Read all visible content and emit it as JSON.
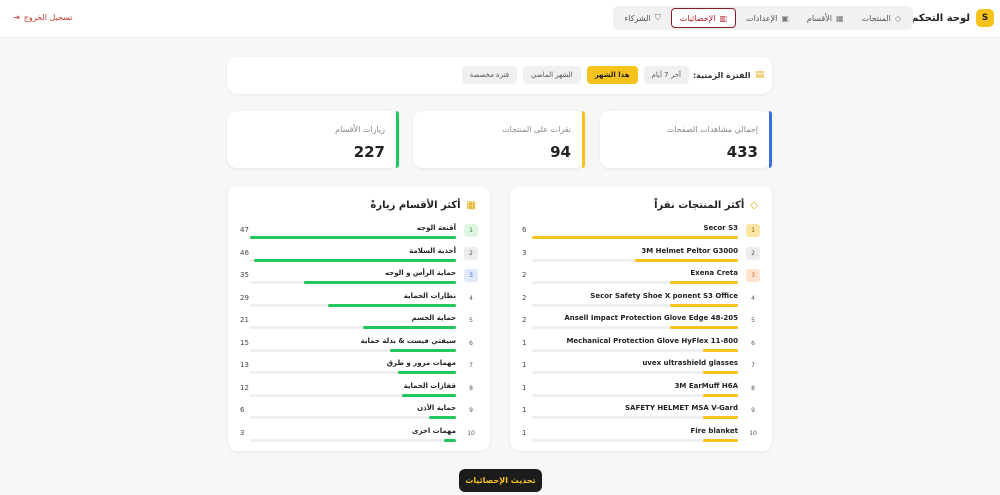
{
  "header": {
    "brand_letter": "S",
    "title": "لوحة التحكم",
    "logout_label": "تسجيل الخروج",
    "nav": [
      {
        "label": "المنتجات",
        "icon": "tag-icon",
        "active": false
      },
      {
        "label": "الأقسام",
        "icon": "grid-icon",
        "active": false
      },
      {
        "label": "الإعدادات",
        "icon": "image-icon",
        "active": false
      },
      {
        "label": "الإحصائيات",
        "icon": "bar-chart-icon",
        "active": true
      },
      {
        "label": "الشركاء",
        "icon": "handshake-icon",
        "active": false
      }
    ]
  },
  "period": {
    "label": "الفترة الزمنية:",
    "options": [
      {
        "label": "آخر 7 أيام",
        "active": false
      },
      {
        "label": "هذا الشهر",
        "active": true
      },
      {
        "label": "الشهر الماضي",
        "active": false
      },
      {
        "label": "فترة مخصصة",
        "active": false
      }
    ]
  },
  "stats": [
    {
      "label": "إجمالي مشاهدات الصفحات",
      "value": "433",
      "accent": "#3b6fd8"
    },
    {
      "label": "نقرات على المنتجات",
      "value": "94",
      "accent": "#f6c21c"
    },
    {
      "label": "زيارات الأقسام",
      "value": "227",
      "accent": "#22c55e"
    }
  ],
  "top_products": {
    "title": "أكثر المنتجات نقراً",
    "color": "#f6c21c",
    "items": [
      {
        "rank": "1",
        "name": "Secor S3",
        "count": "6",
        "fraction": 1.0
      },
      {
        "rank": "2",
        "name": "3M Helmet Peltor G3000",
        "count": "3",
        "fraction": 0.5
      },
      {
        "rank": "3",
        "name": "Exena Creta",
        "count": "2",
        "fraction": 0.33
      },
      {
        "rank": "4",
        "name": "Secor Safety Shoe X ponent S3 Office",
        "count": "2",
        "fraction": 0.33
      },
      {
        "rank": "5",
        "name": "Ansell Impact Protection Glove Edge 48-205",
        "count": "2",
        "fraction": 0.33
      },
      {
        "rank": "6",
        "name": "Mechanical Protection Glove HyFlex 11-800",
        "count": "1",
        "fraction": 0.17
      },
      {
        "rank": "7",
        "name": "uvex ultrashield glasses",
        "count": "1",
        "fraction": 0.17
      },
      {
        "rank": "8",
        "name": "3M EarMuff H6A",
        "count": "1",
        "fraction": 0.17
      },
      {
        "rank": "9",
        "name": "SAFETY HELMET MSA V-Gard",
        "count": "1",
        "fraction": 0.17
      },
      {
        "rank": "10",
        "name": "Fire blanket",
        "count": "1",
        "fraction": 0.17
      }
    ]
  },
  "top_categories": {
    "title": "أكثر الأقسام زيارةً",
    "color": "#22c55e",
    "items": [
      {
        "rank": "1",
        "name": "أقنعة الوجه",
        "count": "47",
        "fraction": 1.0
      },
      {
        "rank": "2",
        "name": "أحذية السلامة",
        "count": "46",
        "fraction": 0.98
      },
      {
        "rank": "3",
        "name": "حماية الرأس و الوجه",
        "count": "35",
        "fraction": 0.74
      },
      {
        "rank": "4",
        "name": "نظارات الحماية",
        "count": "29",
        "fraction": 0.62
      },
      {
        "rank": "5",
        "name": "حماية الجسم",
        "count": "21",
        "fraction": 0.45
      },
      {
        "rank": "6",
        "name": "سيفتي فيست & بدلة حماية",
        "count": "15",
        "fraction": 0.32
      },
      {
        "rank": "7",
        "name": "مهمات مرور و طرق",
        "count": "13",
        "fraction": 0.28
      },
      {
        "rank": "8",
        "name": "قفازات الحماية",
        "count": "12",
        "fraction": 0.26
      },
      {
        "rank": "9",
        "name": "حماية الأذن",
        "count": "6",
        "fraction": 0.13
      },
      {
        "rank": "10",
        "name": "مهمات اخرى",
        "count": "3",
        "fraction": 0.06
      }
    ]
  },
  "refresh_label": "تحديث الإحصائيات"
}
